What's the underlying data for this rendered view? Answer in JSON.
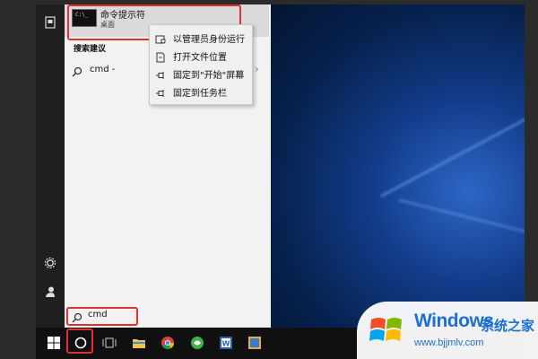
{
  "start_menu": {
    "best_match": {
      "title": "命令提示符",
      "subtitle": "桌面",
      "icon_text": "C:\\_"
    },
    "section_title": "搜索建议",
    "suggestion": {
      "text": "cmd -"
    }
  },
  "context_menu": {
    "items": [
      {
        "label": "以管理员身份运行",
        "icon": "shield-icon"
      },
      {
        "label": "打开文件位置",
        "icon": "file-icon"
      },
      {
        "label": "固定到\"开始\"屏幕",
        "icon": "pin-icon"
      },
      {
        "label": "固定到任务栏",
        "icon": "pin-icon"
      }
    ]
  },
  "search": {
    "value": "cmd"
  },
  "taskbar": {
    "items": [
      "windows-logo-icon",
      "cortana-icon",
      "task-view-icon",
      "file-explorer-icon",
      "chrome-icon",
      "green-app-icon",
      "word-icon",
      "blue-app-icon"
    ]
  },
  "watermark": {
    "brand": "Windows",
    "brand_cn": "系统之家",
    "url": "www.bjjmlv.com"
  },
  "colors": {
    "highlight": "#e03030",
    "panel": "#f2f2f2",
    "taskbar": "#101010",
    "watermark_blue": "#1d6fd1"
  }
}
